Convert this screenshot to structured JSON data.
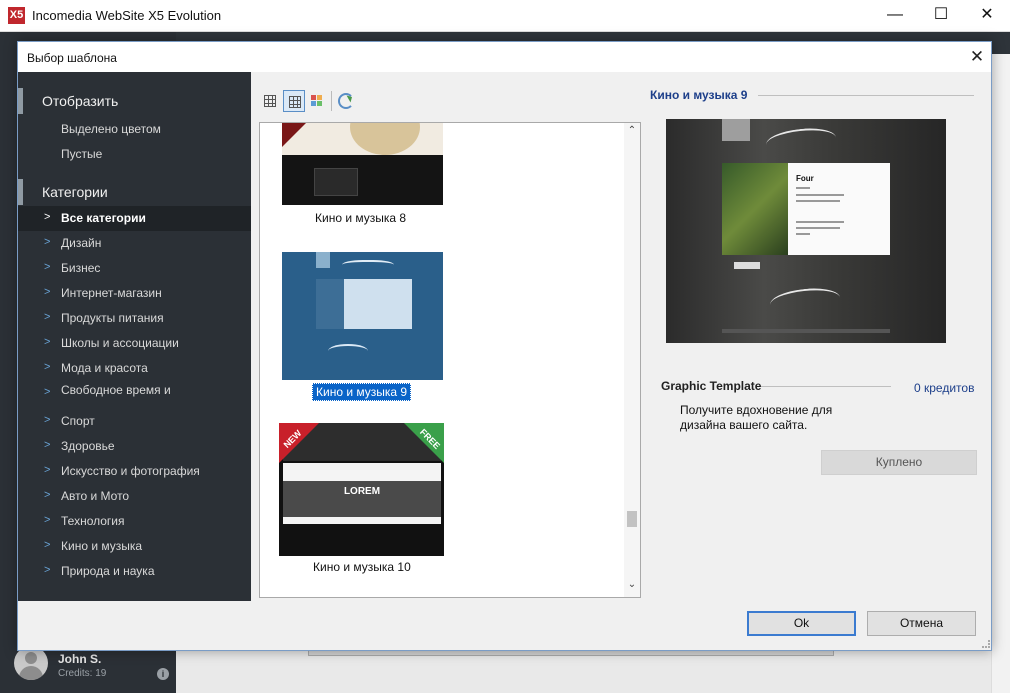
{
  "app": {
    "title": "Incomedia WebSite X5 Evolution",
    "logo_glyph": "X5",
    "minimize_glyph": "—",
    "maximize_glyph": "☐",
    "close_glyph": "✕"
  },
  "user": {
    "name": "John S.",
    "credits": "Credits: 19",
    "info_glyph": "i"
  },
  "dialog": {
    "title": "Выбор шаблона",
    "close_glyph": "✕",
    "ok_label": "Ok",
    "cancel_label": "Отмена"
  },
  "sidebar": {
    "display_header": "Отобразить",
    "display_items": [
      "Выделено цветом",
      "Пустые"
    ],
    "categories_header": "Категории",
    "chevron": ">",
    "categories": [
      {
        "label": "Все категории",
        "active": true
      },
      {
        "label": "Дизайн"
      },
      {
        "label": "Бизнес"
      },
      {
        "label": "Интернет-магазин"
      },
      {
        "label": "Продукты питания"
      },
      {
        "label": "Школы и ассоциации"
      },
      {
        "label": "Мода и красота"
      },
      {
        "label": "Свободное время и"
      },
      {
        "label": "Спорт"
      },
      {
        "label": "Здоровье"
      },
      {
        "label": "Искусство и фотография"
      },
      {
        "label": "Авто и Мото"
      },
      {
        "label": "Технология"
      },
      {
        "label": "Кино и музыка"
      },
      {
        "label": "Природа и наука"
      }
    ]
  },
  "templates": {
    "items": [
      {
        "name": "Кино и музыка 8",
        "selected": false
      },
      {
        "name": "Кино и музыка 9",
        "selected": true
      },
      {
        "name": "Кино и музыка 10",
        "selected": false,
        "badges": [
          "NEW",
          "FREE"
        ],
        "banner_text": "LOREM"
      }
    ],
    "scroll_up_glyph": "⌃",
    "scroll_down_glyph": "⌄"
  },
  "preview": {
    "title": "Кино и музыка 9",
    "card_heading": "Four",
    "type_label": "Graphic Template",
    "credits": "0 кредитов",
    "description": "Получите вдохновение для дизайна вашего сайта.",
    "bought_label": "Куплено"
  },
  "colors": {
    "sidebar_bg": "#2b3036",
    "selection": "#0a64c8",
    "link_blue": "#1d3f8a",
    "badge_new": "#c8202a",
    "badge_free": "#3aa04a"
  }
}
